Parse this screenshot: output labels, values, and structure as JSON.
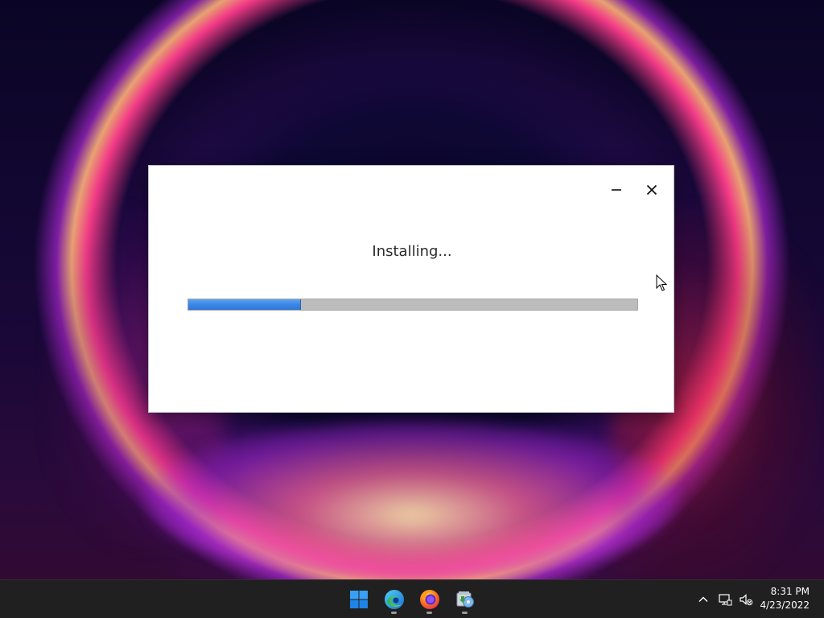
{
  "installer": {
    "status_text": "Installing...",
    "progress": 0.25,
    "accent_color": "#3c87e6",
    "track_color": "#bcbcbc",
    "minimize_icon": "minimize-icon",
    "close_icon": "close-icon"
  },
  "taskbar": {
    "apps": [
      {
        "name": "Start",
        "icon": "windows-logo-icon",
        "running": false
      },
      {
        "name": "Microsoft Edge",
        "icon": "edge-icon",
        "running": true
      },
      {
        "name": "Firefox",
        "icon": "firefox-icon",
        "running": true
      },
      {
        "name": "Installer",
        "icon": "installer-icon",
        "running": true
      }
    ],
    "tray": {
      "chevron_icon": "chevron-up-icon",
      "network_icon": "network-icon",
      "volume_icon": "volume-muted-icon"
    },
    "clock": {
      "time": "8:31 PM",
      "date": "4/23/2022"
    }
  }
}
